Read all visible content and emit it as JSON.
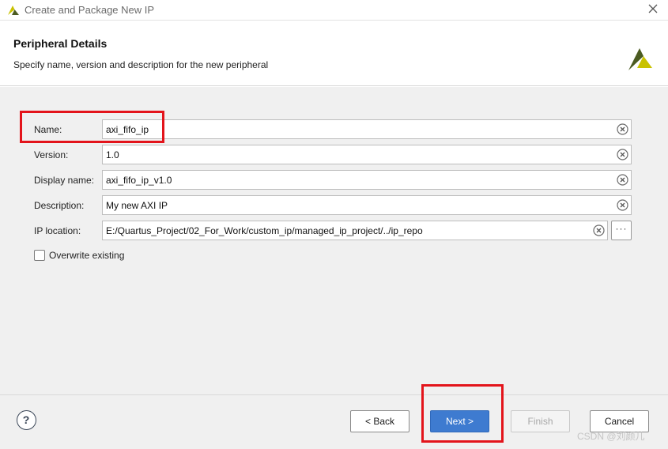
{
  "window": {
    "title": "Create and Package New IP",
    "logo_icon": "vivado-logo-icon",
    "close_icon": "close-icon"
  },
  "header": {
    "title": "Peripheral Details",
    "subtitle": "Specify name, version and description for the new peripheral",
    "brand_icon": "xilinx-logo-icon"
  },
  "form": {
    "fields": [
      {
        "label": "Name:",
        "value": "axi_fifo_ip"
      },
      {
        "label": "Version:",
        "value": "1.0"
      },
      {
        "label": "Display name:",
        "value": "axi_fifo_ip_v1.0"
      },
      {
        "label": "Description:",
        "value": "My new AXI IP"
      },
      {
        "label": "IP location:",
        "value": "E:/Quartus_Project/02_For_Work/custom_ip/managed_ip_project/../ip_repo"
      }
    ],
    "browse_label": "···",
    "overwrite_label": "Overwrite existing",
    "overwrite_checked": false
  },
  "footer": {
    "help_label": "?",
    "back_label": "< Back",
    "next_label": "Next >",
    "finish_label": "Finish",
    "cancel_label": "Cancel"
  },
  "colors": {
    "accent": "#3e7bd0",
    "highlight": "#e3141b",
    "logo_yellow": "#c9c200",
    "logo_dark": "#4b5b21"
  },
  "watermark": "CSDN @刘颜儿"
}
